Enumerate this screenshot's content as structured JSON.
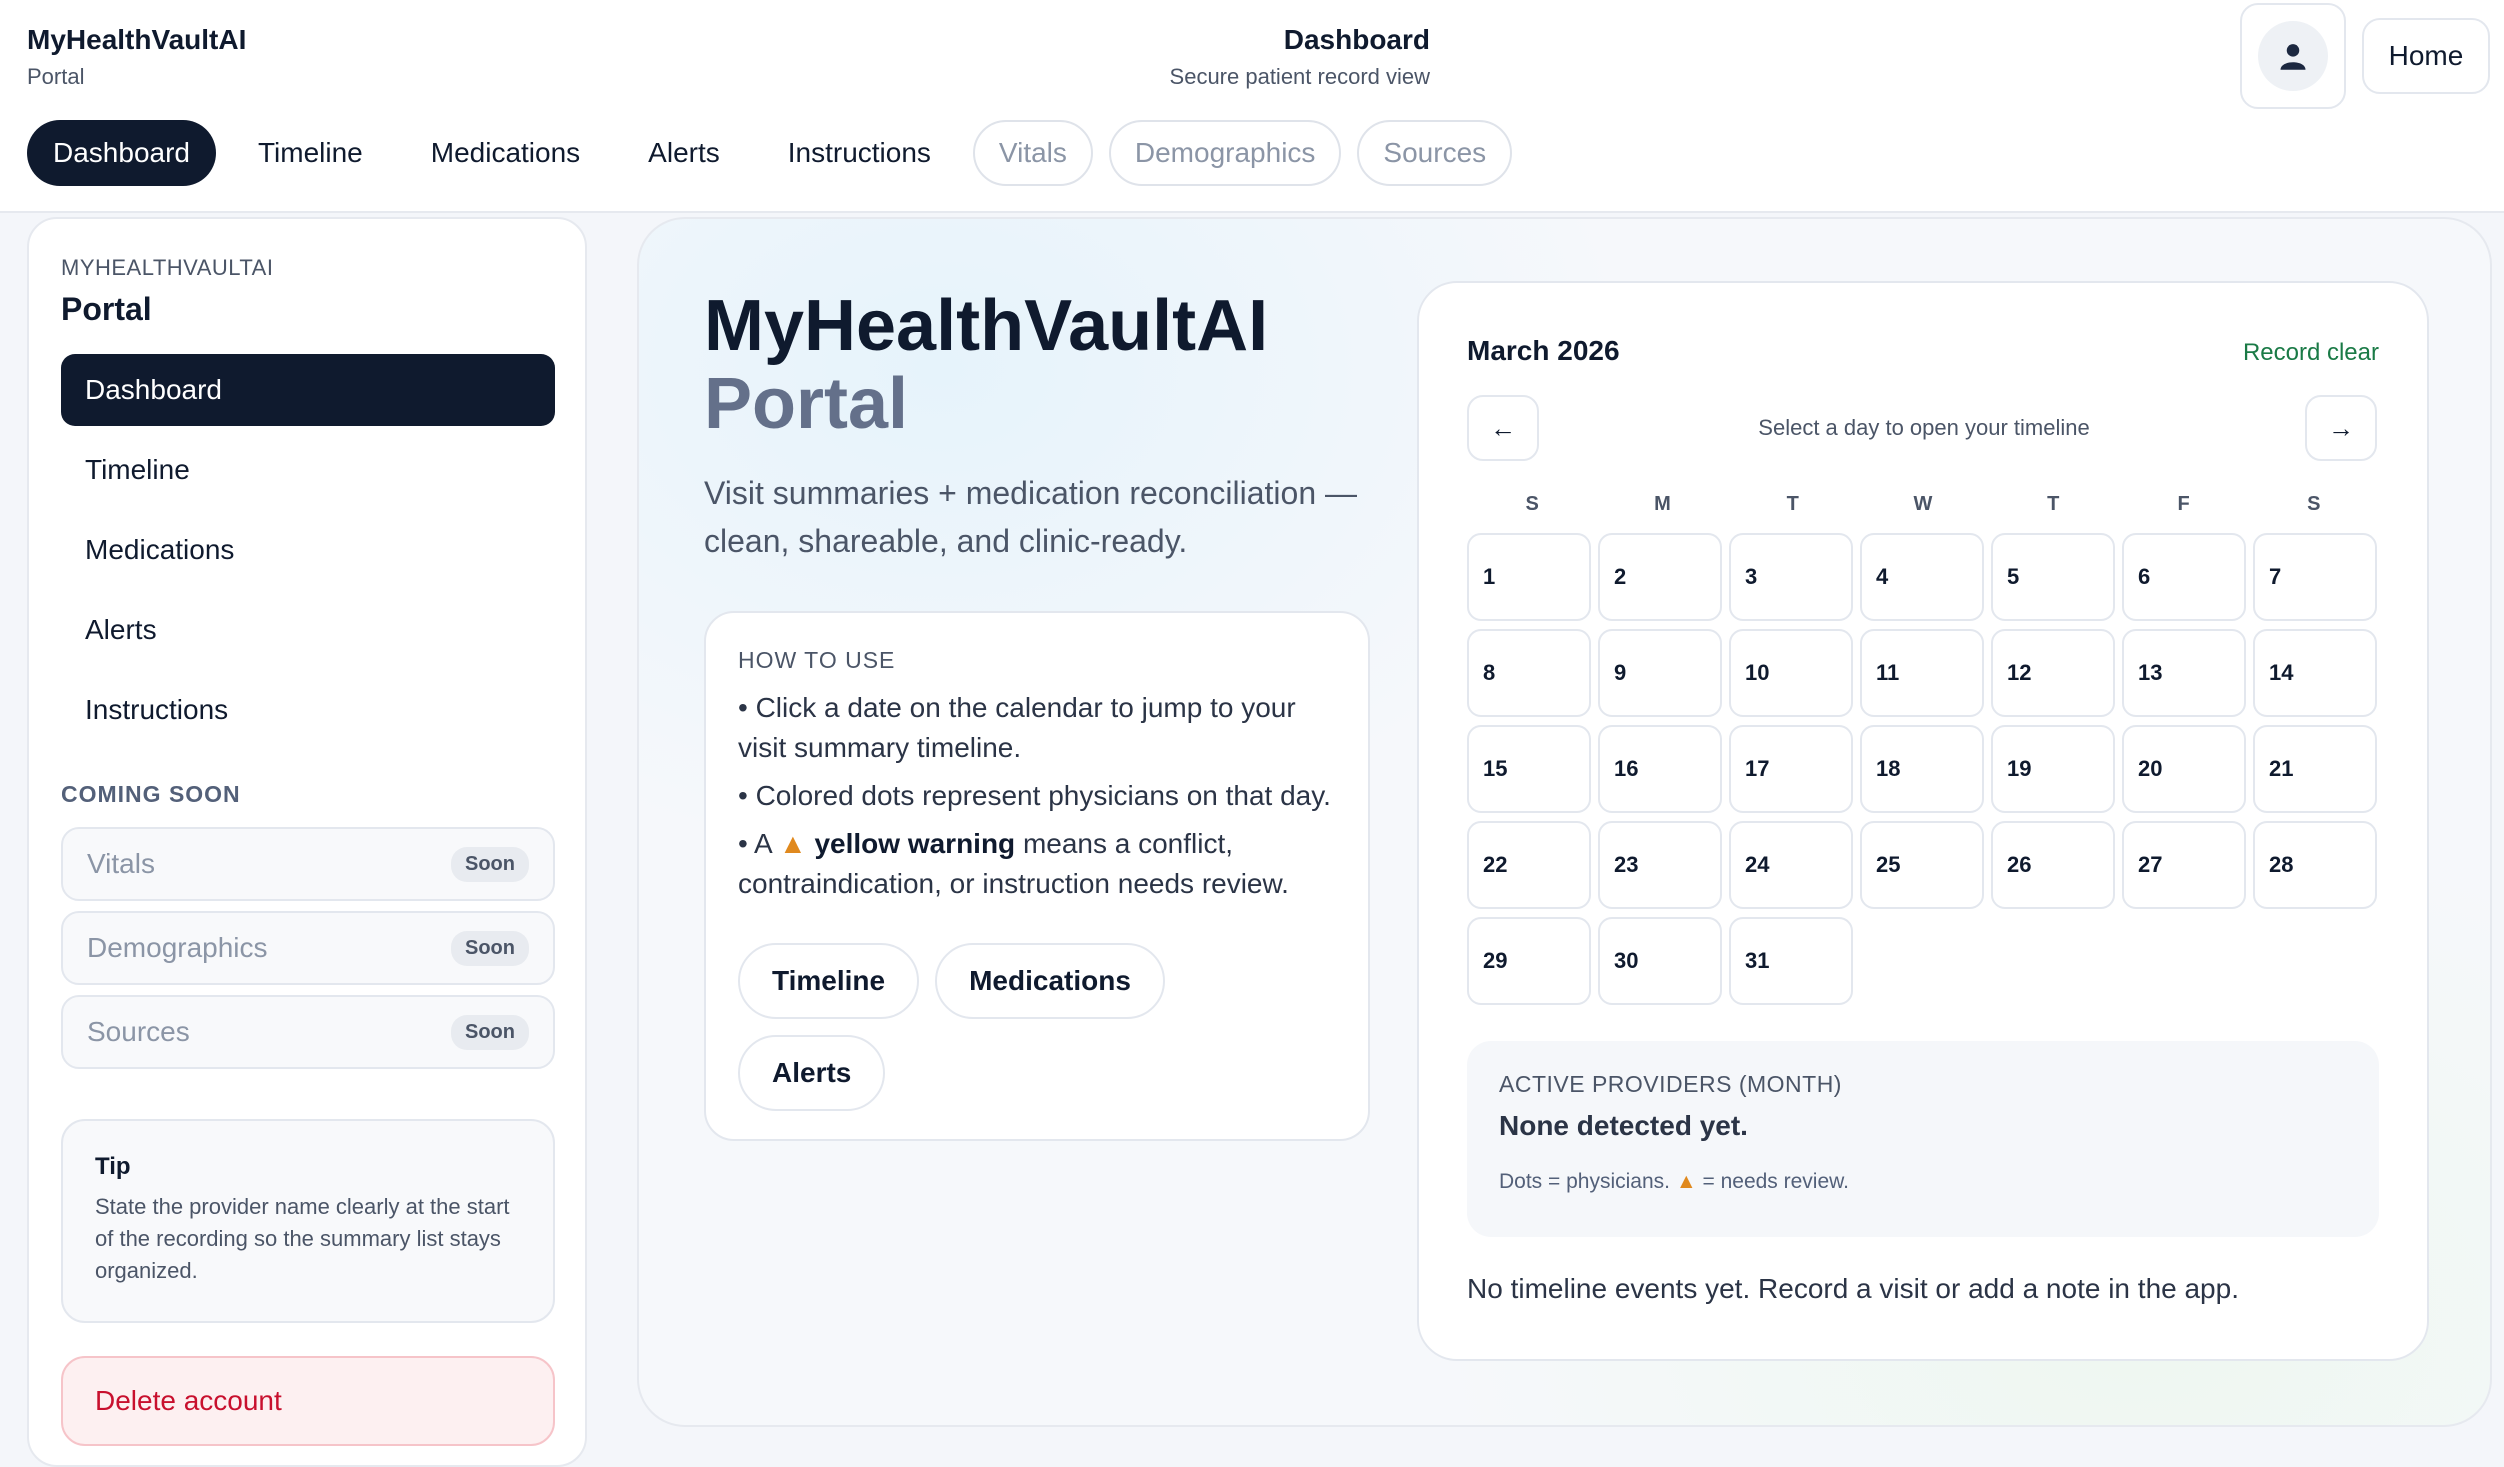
{
  "app": {
    "title": "MyHealthVaultAI",
    "subtitle": "Portal"
  },
  "page": {
    "title": "Dashboard",
    "subtitle": "Secure patient record view"
  },
  "header": {
    "home_label": "Home",
    "avatar_icon": "user-icon"
  },
  "topnav": {
    "tabs": [
      {
        "label": "Dashboard",
        "state": "active"
      },
      {
        "label": "Timeline",
        "state": "normal"
      },
      {
        "label": "Medications",
        "state": "normal"
      },
      {
        "label": "Alerts",
        "state": "normal"
      },
      {
        "label": "Instructions",
        "state": "normal"
      },
      {
        "label": "Vitals",
        "state": "soon"
      },
      {
        "label": "Demographics",
        "state": "soon"
      },
      {
        "label": "Sources",
        "state": "soon"
      }
    ]
  },
  "sidebar": {
    "brand_kicker": "MYHEALTHVAULTAI",
    "brand_title": "Portal",
    "items": [
      {
        "label": "Dashboard",
        "active": true
      },
      {
        "label": "Timeline",
        "active": false
      },
      {
        "label": "Medications",
        "active": false
      },
      {
        "label": "Alerts",
        "active": false
      },
      {
        "label": "Instructions",
        "active": false
      }
    ],
    "coming_soon_title": "COMING SOON",
    "soon_items": [
      {
        "label": "Vitals",
        "badge": "Soon"
      },
      {
        "label": "Demographics",
        "badge": "Soon"
      },
      {
        "label": "Sources",
        "badge": "Soon"
      }
    ],
    "tip": {
      "title": "Tip",
      "body": "State the provider name clearly at the start of the recording so the summary list stays organized."
    },
    "delete_label": "Delete account"
  },
  "hero": {
    "title_line1": "MyHealthVaultAI",
    "title_line2": "Portal",
    "description": "Visit summaries + medication reconciliation — clean, shareable, and clinic-ready."
  },
  "howto": {
    "kicker": "HOW TO USE",
    "bullet1": "• Click a date on the calendar to jump to your visit summary timeline.",
    "bullet2": "• Colored dots represent physicians on that day.",
    "bullet3_pre": "• A",
    "bullet3_icon": "▲",
    "bullet3_bold": "yellow warning",
    "bullet3_post": "means a conflict, contraindication, or instruction needs review.",
    "buttons": [
      "Timeline",
      "Medications",
      "Alerts"
    ]
  },
  "calendar": {
    "month_label": "March 2026",
    "status": "Record clear",
    "prev_label": "←",
    "next_label": "→",
    "hint": "Select a day to open your timeline",
    "weekdays": [
      "S",
      "M",
      "T",
      "W",
      "T",
      "F",
      "S"
    ],
    "days": [
      1,
      2,
      3,
      4,
      5,
      6,
      7,
      8,
      9,
      10,
      11,
      12,
      13,
      14,
      15,
      16,
      17,
      18,
      19,
      20,
      21,
      22,
      23,
      24,
      25,
      26,
      27,
      28,
      29,
      30,
      31
    ],
    "providers_title": "ACTIVE PROVIDERS (MONTH)",
    "providers_value": "None detected yet.",
    "legend_pre": "Dots = physicians.",
    "legend_icon": "▲",
    "legend_post": "= needs review.",
    "empty_message": "No timeline events yet. Record a visit or add a note in the app."
  },
  "colors": {
    "primary": "#0f1a2e",
    "success": "#1a7a46",
    "warning": "#e0891e",
    "danger": "#c8102e"
  }
}
